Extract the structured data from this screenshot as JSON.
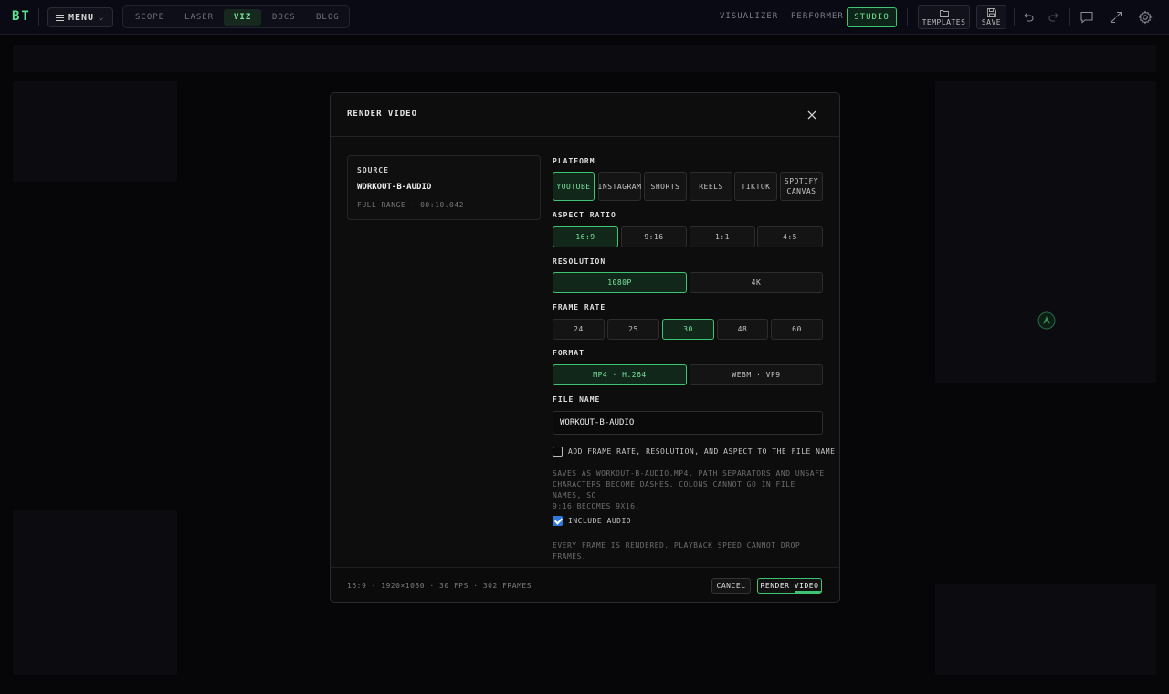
{
  "app": {
    "logo": "BT",
    "menu_label": "MENU",
    "nav_tabs": [
      {
        "label": "SCOPE",
        "active": false
      },
      {
        "label": "LASER",
        "active": false
      },
      {
        "label": "VIZ",
        "active": true
      },
      {
        "label": "DOCS",
        "active": false
      },
      {
        "label": "BLOG",
        "active": false
      }
    ],
    "modes": [
      "VISUALIZER",
      "PERFORMER",
      "STUDIO"
    ],
    "active_mode": "STUDIO",
    "templates_label": "TEMPLATES",
    "save_label": "SAVE",
    "icons": [
      "folder-icon",
      "save-icon",
      "undo-icon",
      "redo-icon",
      "comment-icon",
      "expand-icon",
      "gear-icon"
    ]
  },
  "dialog": {
    "title": "RENDER VIDEO",
    "source": {
      "label": "SOURCE",
      "name": "WORKOUT-B-AUDIO",
      "range": "FULL RANGE · 00:10.042"
    },
    "platform": {
      "label": "PLATFORM",
      "options": [
        "YOUTUBE",
        "INSTAGRAM",
        "SHORTS",
        "REELS",
        "TIKTOK",
        "SPOTIFY CANVAS"
      ],
      "selected": "YOUTUBE"
    },
    "aspect_ratio": {
      "label": "ASPECT RATIO",
      "options": [
        "16:9",
        "9:16",
        "1:1",
        "4:5"
      ],
      "selected": "16:9"
    },
    "resolution": {
      "label": "RESOLUTION",
      "options": [
        "1080P",
        "4K"
      ],
      "selected": "1080P"
    },
    "frame_rate": {
      "label": "FRAME RATE",
      "options": [
        "24",
        "25",
        "30",
        "48",
        "60"
      ],
      "selected": "30"
    },
    "format": {
      "label": "FORMAT",
      "options": [
        "MP4 · H.264",
        "WEBM · VP9"
      ],
      "selected": "MP4 · H.264"
    },
    "file_name": {
      "label": "FILE NAME",
      "value": "WORKOUT-B-AUDIO"
    },
    "append_checkbox": {
      "label": "ADD FRAME RATE, RESOLUTION, AND ASPECT TO THE FILE NAME",
      "checked": false
    },
    "save_note_lines": [
      "SAVES AS WORKOUT-B-AUDIO.mp4. PATH SEPARATORS AND UNSAFE",
      "CHARACTERS BECOME DASHES. COLONS CANNOT GO IN FILE NAMES, SO",
      "9:16 BECOMES 9X16."
    ],
    "audio_checkbox": {
      "label": "INCLUDE AUDIO",
      "checked": true
    },
    "frame_note": "EVERY FRAME IS RENDERED. PLAYBACK SPEED CANNOT DROP FRAMES.",
    "summary": "16:9 · 1920×1080 · 30 FPS · 302 FRAMES",
    "cancel_label": "CANCEL",
    "render_label": "RENDER VIDEO"
  },
  "colors": {
    "accent": "#3fc474",
    "accent_text": "#7be6a0",
    "checkbox_blue": "#2f7ad8"
  }
}
